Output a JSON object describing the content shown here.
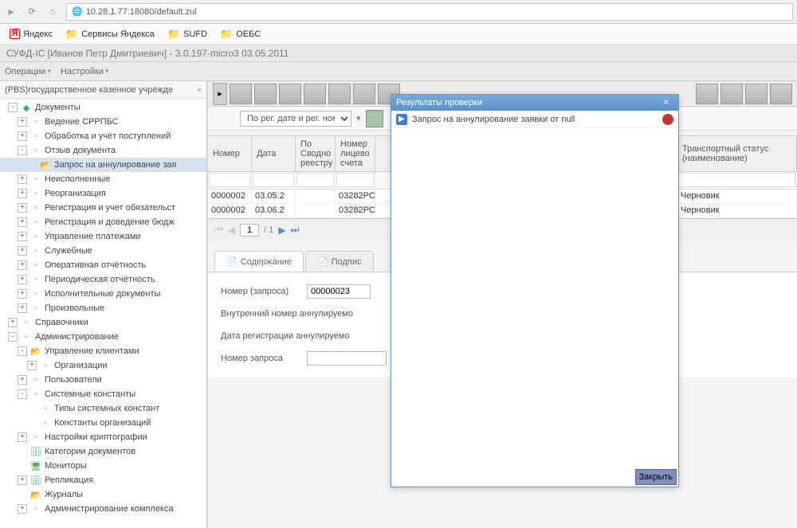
{
  "browser": {
    "url": "10.28.1.77:18080/default.zul",
    "bookmarks": [
      "Яндекс",
      "Сервисы Яндекса",
      "SUFD",
      "ОЕБС"
    ]
  },
  "app_title": "СУФД-IС [Иванов Петр Дмитриевич] - 3.0.197-micro3 03.05.2011",
  "menu": {
    "ops": "Операции",
    "settings": "Настройки"
  },
  "sidebar": {
    "title": "(PBS)государственное казенное учрежде",
    "nodes": [
      {
        "lvl": 1,
        "ex": "-",
        "ico": "grn",
        "label": "Документы"
      },
      {
        "lvl": 2,
        "ex": "+",
        "ico": "doc",
        "label": "Ведение СРРПБС"
      },
      {
        "lvl": 2,
        "ex": "+",
        "ico": "doc",
        "label": "Обработка и учёт поступлений"
      },
      {
        "lvl": 2,
        "ex": "-",
        "ico": "doc",
        "label": "Отзыв документа"
      },
      {
        "lvl": 3,
        "ex": " ",
        "ico": "folder",
        "label": "Запрос на аннулирование зая",
        "sel": true
      },
      {
        "lvl": 2,
        "ex": "+",
        "ico": "doc",
        "label": "Неисполненные"
      },
      {
        "lvl": 2,
        "ex": "+",
        "ico": "doc",
        "label": "Реорганизация"
      },
      {
        "lvl": 2,
        "ex": "+",
        "ico": "doc",
        "label": "Регистрация и учет обязательст"
      },
      {
        "lvl": 2,
        "ex": "+",
        "ico": "doc",
        "label": "Регистрация и доведение бюдж"
      },
      {
        "lvl": 2,
        "ex": "+",
        "ico": "doc",
        "label": "Управление платежами"
      },
      {
        "lvl": 2,
        "ex": "+",
        "ico": "doc",
        "label": "Служебные"
      },
      {
        "lvl": 2,
        "ex": "+",
        "ico": "doc",
        "label": "Оперативная отчётность"
      },
      {
        "lvl": 2,
        "ex": "+",
        "ico": "doc",
        "label": "Периодическая отчётность"
      },
      {
        "lvl": 2,
        "ex": "+",
        "ico": "doc",
        "label": "Исполнительные документы"
      },
      {
        "lvl": 2,
        "ex": "+",
        "ico": "doc",
        "label": "Произвольные"
      },
      {
        "lvl": 1,
        "ex": "+",
        "ico": "doc",
        "label": "Справочники"
      },
      {
        "lvl": 1,
        "ex": "-",
        "ico": "doc",
        "label": "Администрирование"
      },
      {
        "lvl": 2,
        "ex": "-",
        "ico": "folder",
        "label": "Управление клиентами"
      },
      {
        "lvl": 3,
        "ex": "+",
        "ico": "doc",
        "label": "Организации"
      },
      {
        "lvl": 2,
        "ex": "+",
        "ico": "doc",
        "label": "Пользователи"
      },
      {
        "lvl": 2,
        "ex": "-",
        "ico": "doc",
        "label": "Системные константы"
      },
      {
        "lvl": 3,
        "ex": " ",
        "ico": "doc",
        "label": "Типы системных констант"
      },
      {
        "lvl": 3,
        "ex": " ",
        "ico": "doc",
        "label": "Константы организаций"
      },
      {
        "lvl": 2,
        "ex": "+",
        "ico": "doc",
        "label": "Настройки криптографии"
      },
      {
        "lvl": 2,
        "ex": " ",
        "ico": "db",
        "label": "Категории документов"
      },
      {
        "lvl": 2,
        "ex": " ",
        "ico": "mon",
        "label": "Мониторы"
      },
      {
        "lvl": 2,
        "ex": "+",
        "ico": "db",
        "label": "Репликация"
      },
      {
        "lvl": 2,
        "ex": " ",
        "ico": "folder",
        "label": "Журналы"
      },
      {
        "lvl": 2,
        "ex": "+",
        "ico": "doc",
        "label": "Администрирование комплекса"
      }
    ]
  },
  "filter": {
    "select": "По рег. дате и рег. ном"
  },
  "grid": {
    "headers": [
      "Номер",
      "Дата",
      "По Сводно реестру",
      "Номер лицево счета"
    ],
    "header_tail": "Транспортный статус (наименование)",
    "rows": [
      {
        "num": "0000002",
        "date": "03.05.2",
        "sv": "",
        "acc": "03282PС",
        "tail": "Черновик"
      },
      {
        "num": "0000002",
        "date": "03.06.2",
        "sv": "",
        "acc": "03282PС",
        "tail": "Черновик"
      }
    ]
  },
  "pager": {
    "page": "1",
    "total": "/ 1"
  },
  "tabs": {
    "content": "Содержание",
    "sign": "Подпис"
  },
  "form": {
    "f1_label": "Номер (запроса)",
    "f1_val": "00000023",
    "f2_label": "Внутренний номер аннулируемо",
    "f3_label": "Дата регистрации аннулируемо",
    "f4_label": "Номер запроса"
  },
  "dialog": {
    "title": "Результаты проверки",
    "msg": "Запрос на аннулирование заявки от null",
    "close_btn": "Закрыть"
  }
}
